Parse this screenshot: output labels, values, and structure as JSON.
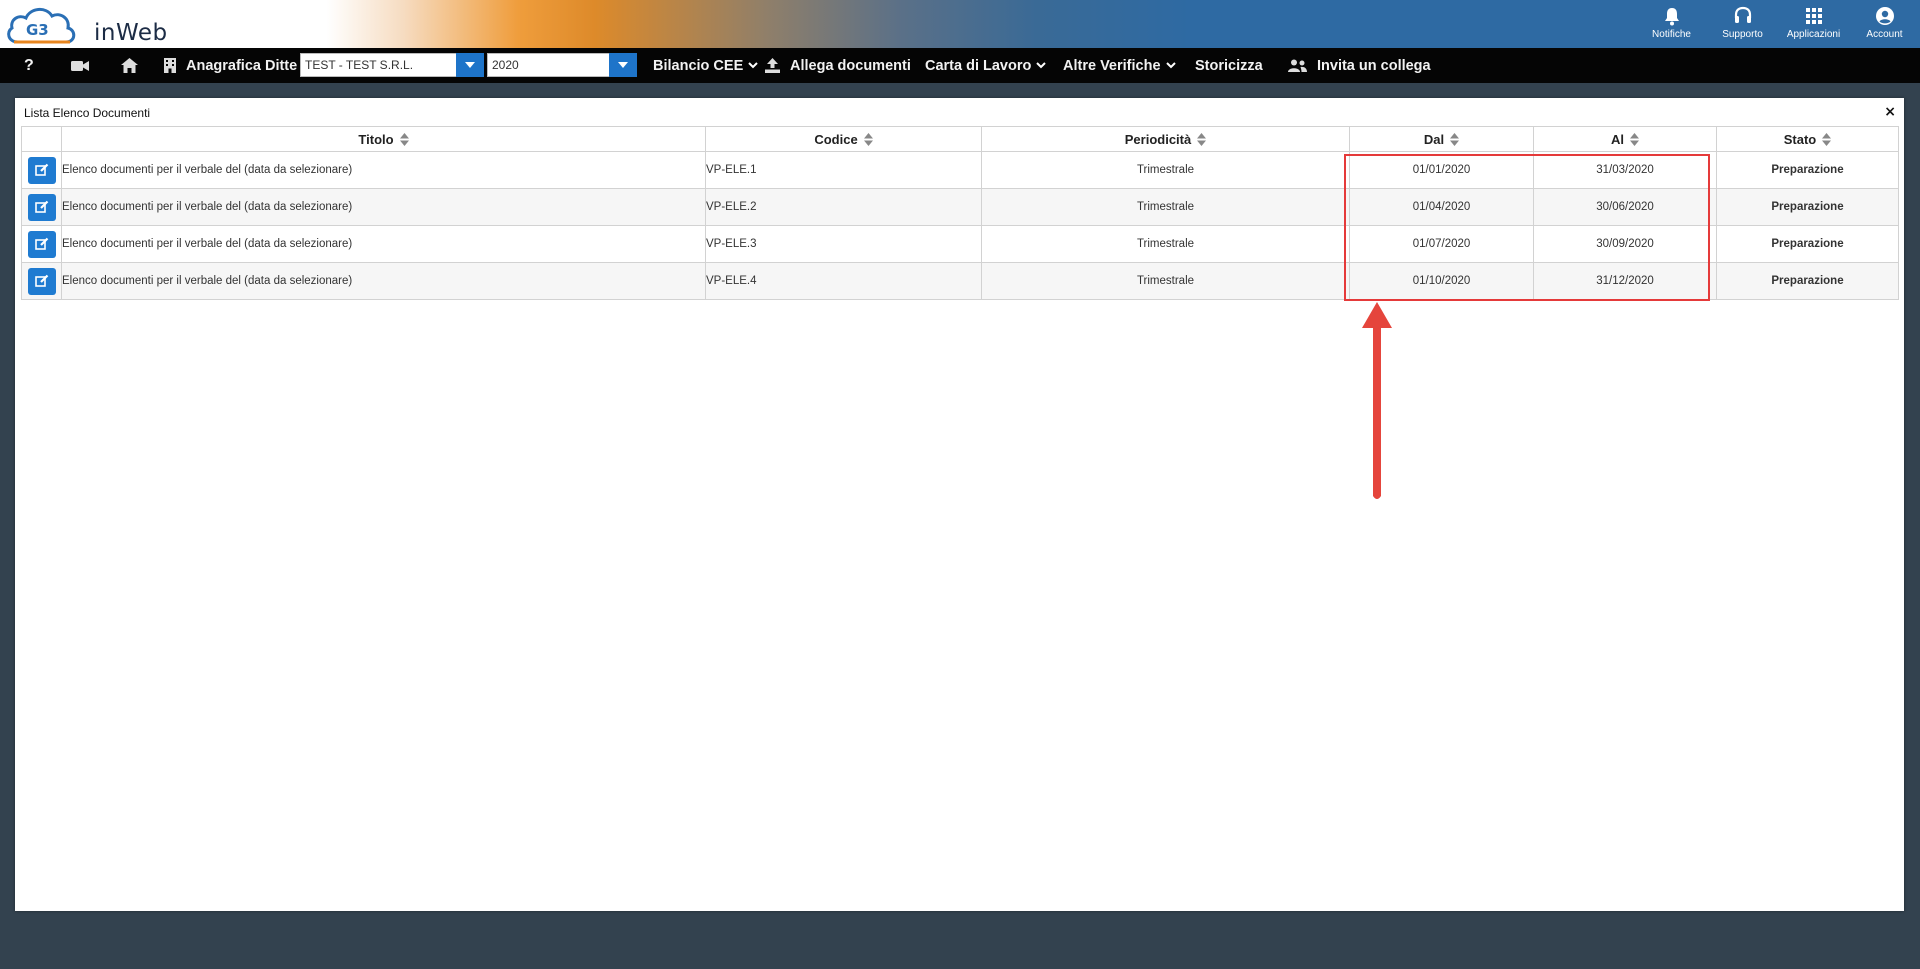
{
  "app": {
    "brand": "inWeb",
    "logo_mark": "G3"
  },
  "top_actions": [
    {
      "label": "Notifiche",
      "icon": "bell-icon"
    },
    {
      "label": "Supporto",
      "icon": "headset-icon"
    },
    {
      "label": "Applicazioni",
      "icon": "grid-icon"
    },
    {
      "label": "Account",
      "icon": "user-circle-icon"
    }
  ],
  "nav": {
    "help_label": "?",
    "anagrafica_label": "Anagrafica Ditte",
    "company_select_value": "TEST - TEST S.R.L.",
    "year_select_value": "2020",
    "bilancio_label": "Bilancio CEE",
    "allega_label": "Allega documenti",
    "carta_label": "Carta di Lavoro",
    "altre_label": "Altre Verifiche",
    "storicizza_label": "Storicizza",
    "invita_label": "Invita un collega"
  },
  "panel": {
    "title": "Lista Elenco Documenti",
    "close_label": "×"
  },
  "table": {
    "columns": [
      "",
      "Titolo",
      "Codice",
      "Periodicità",
      "Dal",
      "Al",
      "Stato"
    ],
    "rows": [
      {
        "titolo": "Elenco documenti per il verbale del (data da selezionare)",
        "codice": "VP-ELE.1",
        "periodicita": "Trimestrale",
        "dal": "01/01/2020",
        "al": "31/03/2020",
        "stato": "Preparazione"
      },
      {
        "titolo": "Elenco documenti per il verbale del (data da selezionare)",
        "codice": "VP-ELE.2",
        "periodicita": "Trimestrale",
        "dal": "01/04/2020",
        "al": "30/06/2020",
        "stato": "Preparazione"
      },
      {
        "titolo": "Elenco documenti per il verbale del (data da selezionare)",
        "codice": "VP-ELE.3",
        "periodicita": "Trimestrale",
        "dal": "01/07/2020",
        "al": "30/09/2020",
        "stato": "Preparazione"
      },
      {
        "titolo": "Elenco documenti per il verbale del (data da selezionare)",
        "codice": "VP-ELE.4",
        "periodicita": "Trimestrale",
        "dal": "01/10/2020",
        "al": "31/12/2020",
        "stato": "Preparazione"
      }
    ]
  },
  "colors": {
    "accent_blue": "#1f7bd1",
    "header_blue": "#2e6aa3",
    "annotation_red": "#e53a3a",
    "page_background": "#33424f"
  }
}
